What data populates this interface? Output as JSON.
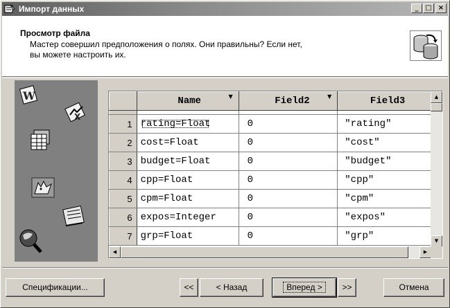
{
  "window": {
    "title": "Импорт данных",
    "title_icon": "import-data-icon",
    "minimize": "_",
    "maximize": "□",
    "close": "×"
  },
  "header": {
    "title": "Просмотр файла",
    "description_line1": "Мастер совершил предположения о полях. Они правильны? Если нет,",
    "description_line2": "вы можете настроить их.",
    "icon": "database-import-icon"
  },
  "left_panel": {
    "icons": [
      "word-document-icon",
      "excel-chart-icon",
      "spreadsheet-icon",
      "foxpro-icon",
      "notepad-icon",
      "query-icon"
    ]
  },
  "grid": {
    "columns": [
      {
        "label": "Name",
        "sort_indicator": "▼"
      },
      {
        "label": "Field2",
        "sort_indicator": "▼"
      },
      {
        "label": "Field3",
        "sort_indicator": ""
      }
    ],
    "rows": [
      {
        "num": "1",
        "c1": "rating=Float",
        "c2": "0",
        "c3": "\"rating\""
      },
      {
        "num": "2",
        "c1": "cost=Float",
        "c2": "0",
        "c3": "\"cost\""
      },
      {
        "num": "3",
        "c1": "budget=Float",
        "c2": "0",
        "c3": "\"budget\""
      },
      {
        "num": "4",
        "c1": "cpp=Float",
        "c2": "0",
        "c3": "\"cpp\""
      },
      {
        "num": "5",
        "c1": "cpm=Float",
        "c2": "0",
        "c3": "\"cpm\""
      },
      {
        "num": "6",
        "c1": "expos=Integer",
        "c2": "0",
        "c3": "\"expos\""
      },
      {
        "num": "7",
        "c1": "grp=Float",
        "c2": "0",
        "c3": "\"grp\""
      }
    ]
  },
  "buttons": {
    "specs": "Спецификации...",
    "first": "<<",
    "back": "< Назад",
    "next": "Вперед >",
    "last": ">>",
    "cancel": "Отмена"
  },
  "colors": {
    "face": "#d4d0c8",
    "dark_shadow": "#404040",
    "shadow": "#808080",
    "panel": "#808080"
  }
}
